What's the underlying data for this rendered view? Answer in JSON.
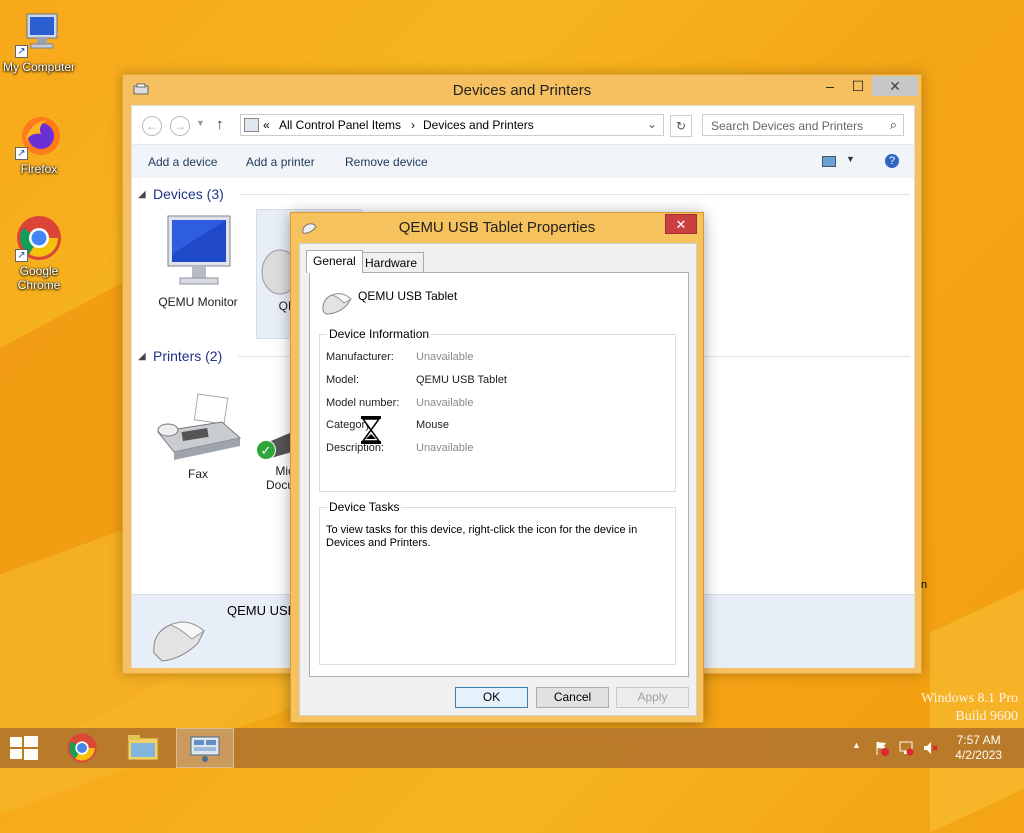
{
  "desktop": {
    "icons": [
      {
        "label": "My Computer",
        "icon": "computer-icon"
      },
      {
        "label": "Firefox",
        "icon": "firefox-icon"
      },
      {
        "label": "Google Chrome",
        "icon": "chrome-icon"
      }
    ],
    "watermark_line1": "Windows 8.1 Pro",
    "watermark_line2": "Build 9600"
  },
  "explorer": {
    "title": "Devices and Printers",
    "breadcrumb_prefix": "«",
    "breadcrumb": [
      "All Control Panel Items",
      "Devices and Printers"
    ],
    "breadcrumb_sep": "›",
    "search_placeholder": "Search Devices and Printers",
    "commands": [
      "Add a device",
      "Add a printer",
      "Remove device"
    ],
    "groups": {
      "devices_label": "Devices (3)",
      "printers_label": "Printers (2)"
    },
    "devices": [
      {
        "label": "QEMU Monitor",
        "icon": "monitor-icon"
      },
      {
        "label": "QE",
        "icon": "mouse-icon"
      }
    ],
    "printers": [
      {
        "label": "Fax",
        "icon": "fax-icon"
      },
      {
        "label_line1": "Mic",
        "label_line2": "Docu",
        "icon": "printer-icon"
      }
    ],
    "details_title": "QEMU USB",
    "stray_char": "n"
  },
  "dialog": {
    "title": "QEMU USB Tablet Properties",
    "tabs": [
      "General",
      "Hardware"
    ],
    "active_tab": "General",
    "device_name": "QEMU USB Tablet",
    "info_legend": "Device Information",
    "info": [
      {
        "label": "Manufacturer:",
        "value": "Unavailable",
        "muted": true
      },
      {
        "label": "Model:",
        "value": "QEMU USB Tablet",
        "muted": false
      },
      {
        "label": "Model number:",
        "value": "Unavailable",
        "muted": true
      },
      {
        "label": "Category:",
        "value": "Mouse",
        "muted": false
      },
      {
        "label": "Description:",
        "value": "Unavailable",
        "muted": true
      }
    ],
    "tasks_legend": "Device Tasks",
    "tasks_text": "To view tasks for this device, right-click the icon for the device in Devices and Printers.",
    "buttons": {
      "ok": "OK",
      "cancel": "Cancel",
      "apply": "Apply"
    }
  },
  "taskbar": {
    "time": "7:57 AM",
    "date": "4/2/2023",
    "tray_arrow": "▲"
  }
}
